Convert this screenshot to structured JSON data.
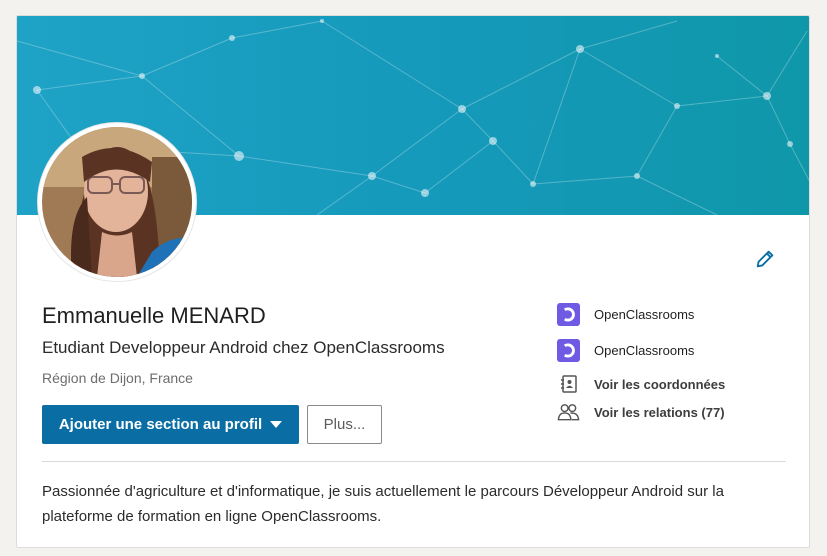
{
  "profile": {
    "name": "Emmanuelle MENARD",
    "headline": "Etudiant Developpeur Android chez OpenClassrooms",
    "location": "Région de Dijon, France"
  },
  "actions": {
    "add_section_label": "Ajouter une section au profil",
    "more_label": "Plus..."
  },
  "sidebar": {
    "items": [
      {
        "label": "OpenClassrooms",
        "icon": "openclassrooms-logo-icon"
      },
      {
        "label": "OpenClassrooms",
        "icon": "openclassrooms-logo-icon"
      },
      {
        "label": "Voir les coordonnées",
        "icon": "contact-book-icon"
      },
      {
        "label": "Voir les relations (77)",
        "icon": "people-icon"
      }
    ]
  },
  "about": {
    "text": "Passionnée d'agriculture et d'informatique, je suis actuellement le parcours Développeur Android sur la plateforme de formation en ligne OpenClassrooms."
  },
  "colors": {
    "banner": "#1ea2c6",
    "primary": "#0a6ea5",
    "brand_logo": "#6f5be3"
  }
}
